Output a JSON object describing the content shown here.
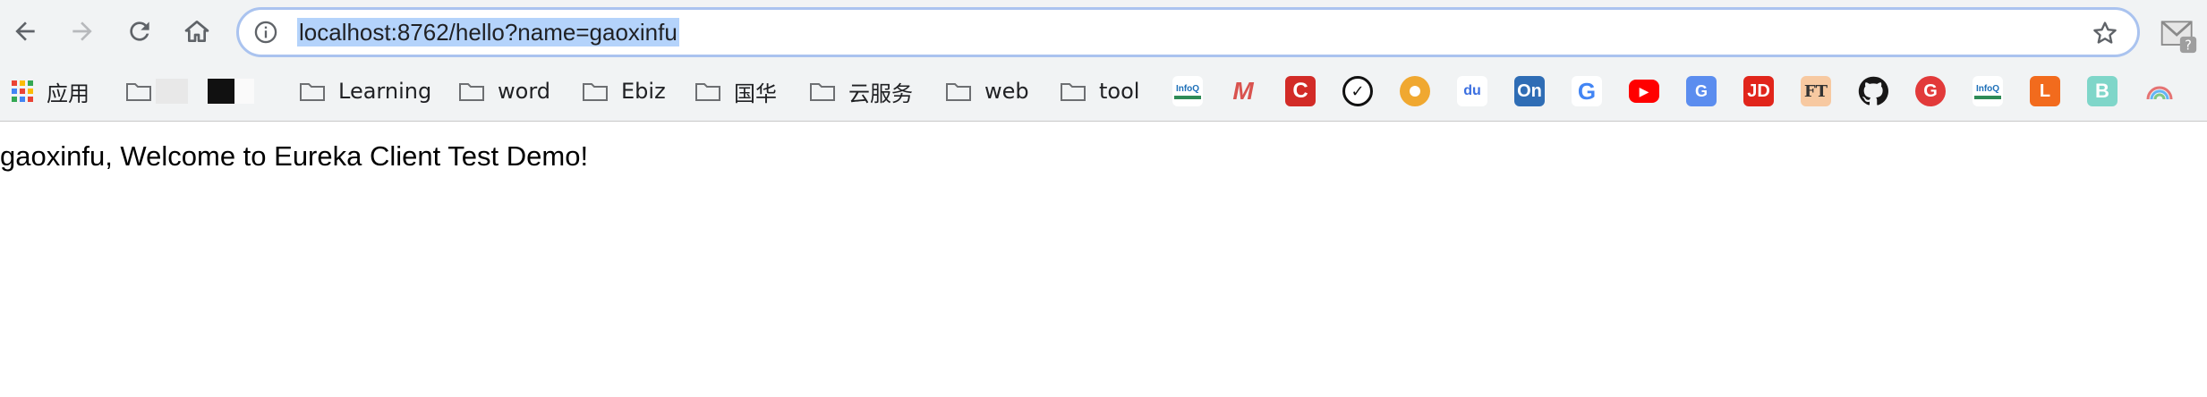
{
  "address_bar": {
    "url": "localhost:8762/hello?name=gaoxinfu"
  },
  "bookmarks": {
    "apps_label": "应用",
    "folders": [
      "Learning",
      "word",
      "Ebiz",
      "国华",
      "云服务",
      "web",
      "tool"
    ],
    "favicons": [
      {
        "name": "infoq",
        "text": "InfoQ",
        "color": "#1d6fb8"
      },
      {
        "name": "m",
        "text": "M",
        "color": "#d9534f"
      },
      {
        "name": "c",
        "text": "C",
        "color": "#d22b27"
      },
      {
        "name": "check",
        "text": "✓",
        "color": "#111111"
      },
      {
        "name": "orange",
        "text": "",
        "color": "#f0a830"
      },
      {
        "name": "baidu",
        "text": "du",
        "color": "#3b6fe0"
      },
      {
        "name": "on",
        "text": "On",
        "color": "#2f6db5"
      },
      {
        "name": "google",
        "text": "G",
        "color": "#4285f4"
      },
      {
        "name": "youtube",
        "text": "▶",
        "color": "#ff0000"
      },
      {
        "name": "translate",
        "text": "G",
        "color": "#5b8def"
      },
      {
        "name": "jd",
        "text": "JD",
        "color": "#e1251b"
      },
      {
        "name": "ft",
        "text": "FT",
        "color": "#f7c9a1"
      },
      {
        "name": "github",
        "text": "",
        "color": "#181717"
      },
      {
        "name": "g-red",
        "text": "G",
        "color": "#e23a3a"
      },
      {
        "name": "infoq2",
        "text": "InfoQ",
        "color": "#1d6fb8"
      },
      {
        "name": "l",
        "text": "L",
        "color": "#f26b1d"
      },
      {
        "name": "b",
        "text": "B",
        "color": "#7fd6c9"
      },
      {
        "name": "rainbow",
        "text": "",
        "color": "#e57373"
      }
    ]
  },
  "page": {
    "text": "gaoxinfu, Welcome to Eureka Client Test Demo!"
  }
}
